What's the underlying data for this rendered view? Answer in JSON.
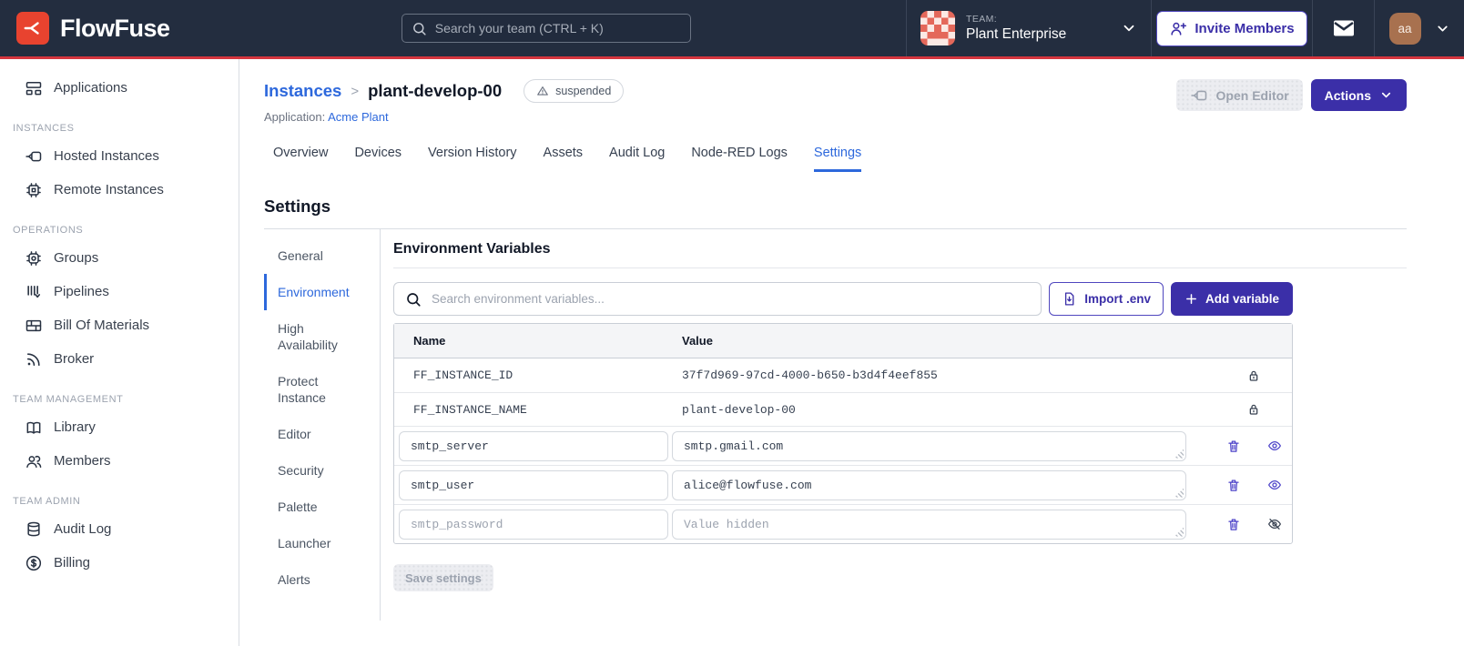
{
  "navbar": {
    "brand": "FlowFuse",
    "logo_icon": "flowfuse-logo-icon",
    "search_icon": "search-icon",
    "search_placeholder": "Search your team (CTRL + K)",
    "team_label": "TEAM:",
    "team_name": "Plant Enterprise",
    "team_avatar_icon": "team-identicon",
    "invite_button": "Invite Members",
    "invite_icon": "user-plus-icon",
    "mail_icon": "envelope-icon",
    "avatar_initials": "aa",
    "chevron_icon": "chevron-down-icon"
  },
  "sidebar": {
    "sections": [
      {
        "title": "",
        "items": [
          {
            "label": "Applications",
            "icon": "applications-icon"
          }
        ]
      },
      {
        "title": "INSTANCES",
        "items": [
          {
            "label": "Hosted Instances",
            "icon": "hosted-instances-icon"
          },
          {
            "label": "Remote Instances",
            "icon": "remote-instances-icon"
          }
        ]
      },
      {
        "title": "OPERATIONS",
        "items": [
          {
            "label": "Groups",
            "icon": "groups-icon"
          },
          {
            "label": "Pipelines",
            "icon": "pipelines-icon"
          },
          {
            "label": "Bill Of Materials",
            "icon": "bill-of-materials-icon"
          },
          {
            "label": "Broker",
            "icon": "broker-icon"
          }
        ]
      },
      {
        "title": "TEAM MANAGEMENT",
        "items": [
          {
            "label": "Library",
            "icon": "library-icon"
          },
          {
            "label": "Members",
            "icon": "members-icon"
          }
        ]
      },
      {
        "title": "TEAM ADMIN",
        "items": [
          {
            "label": "Audit Log",
            "icon": "audit-log-icon"
          },
          {
            "label": "Billing",
            "icon": "billing-icon"
          }
        ]
      }
    ]
  },
  "header": {
    "breadcrumb_parent": "Instances",
    "breadcrumb_separator": ">",
    "instance_name": "plant-develop-00",
    "status_badge": "suspended",
    "status_icon": "warning-triangle-icon",
    "application_label": "Application:",
    "application_name": "Acme Plant",
    "open_editor_label": "Open Editor",
    "open_editor_icon": "node-editor-icon",
    "actions_label": "Actions",
    "actions_icon": "chevron-down-icon"
  },
  "tabs": {
    "items": [
      "Overview",
      "Devices",
      "Version History",
      "Assets",
      "Audit Log",
      "Node-RED Logs",
      "Settings"
    ],
    "active": "Settings"
  },
  "settings": {
    "title": "Settings",
    "nav": [
      "General",
      "Environment",
      "High Availability",
      "Protect Instance",
      "Editor",
      "Security",
      "Palette",
      "Launcher",
      "Alerts"
    ],
    "active": "Environment"
  },
  "environment": {
    "title": "Environment Variables",
    "search_placeholder": "Search environment variables...",
    "search_icon": "search-icon",
    "import_label": "Import .env",
    "import_icon": "import-file-icon",
    "add_label": "Add variable",
    "add_icon": "plus-icon",
    "table": {
      "columns": [
        "Name",
        "Value"
      ],
      "locked_rows": [
        {
          "name": "FF_INSTANCE_ID",
          "value": "37f7d969-97cd-4000-b650-b3d4f4eef855",
          "icon": "lock-icon"
        },
        {
          "name": "FF_INSTANCE_NAME",
          "value": "plant-develop-00",
          "icon": "lock-icon"
        }
      ],
      "rows": [
        {
          "name": "smtp_server",
          "value": "smtp.gmail.com",
          "icons": [
            "trash-icon",
            "eye-icon"
          ]
        },
        {
          "name": "smtp_user",
          "value": "alice@flowfuse.com",
          "icons": [
            "trash-icon",
            "eye-icon"
          ]
        },
        {
          "name": "smtp_password",
          "value": "",
          "value_placeholder": "Value hidden",
          "icons": [
            "trash-icon",
            "eye-off-icon"
          ]
        }
      ]
    },
    "save_label": "Save settings"
  },
  "colors": {
    "navbar_bg": "#232D3F",
    "accent_bar": "#D5353E",
    "logo_red": "#E8432F",
    "link_blue": "#2D68DC",
    "button_indigo": "#3B2FA8",
    "icon_indigo": "#4C42C8",
    "avatar_brown": "#A8714F",
    "team_avatar_salmon": "#E4685A",
    "disabled_text": "#9CA3AF"
  }
}
